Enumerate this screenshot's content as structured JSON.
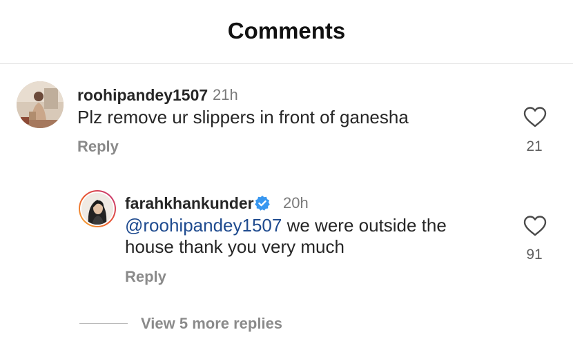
{
  "header": {
    "title": "Comments"
  },
  "comments": [
    {
      "username": "roohipandey1507",
      "time": "21h",
      "text": "Plz remove ur slippers in front of ganesha",
      "reply_label": "Reply",
      "likes": "21",
      "avatar_icon": "user-photo-avatar",
      "like_icon": "heart-outline-icon"
    }
  ],
  "reply": {
    "username": "farahkhankunder",
    "verified_icon": "verified-badge-icon",
    "verified_color": "#3897f0",
    "time": "20h",
    "mention": "@roohipandey1507",
    "text_line1": " we were outside the",
    "text_line2": "house thank you very much",
    "reply_label": "Reply",
    "likes": "91",
    "avatar_icon": "user-photo-avatar",
    "story_ring_colors": [
      "#f9b233",
      "#e8532f",
      "#c13584"
    ],
    "like_icon": "heart-outline-icon"
  },
  "view_more": {
    "label": "View 5 more replies"
  },
  "colors": {
    "mention": "#1f4b8f",
    "muted": "#8a8a8a"
  }
}
